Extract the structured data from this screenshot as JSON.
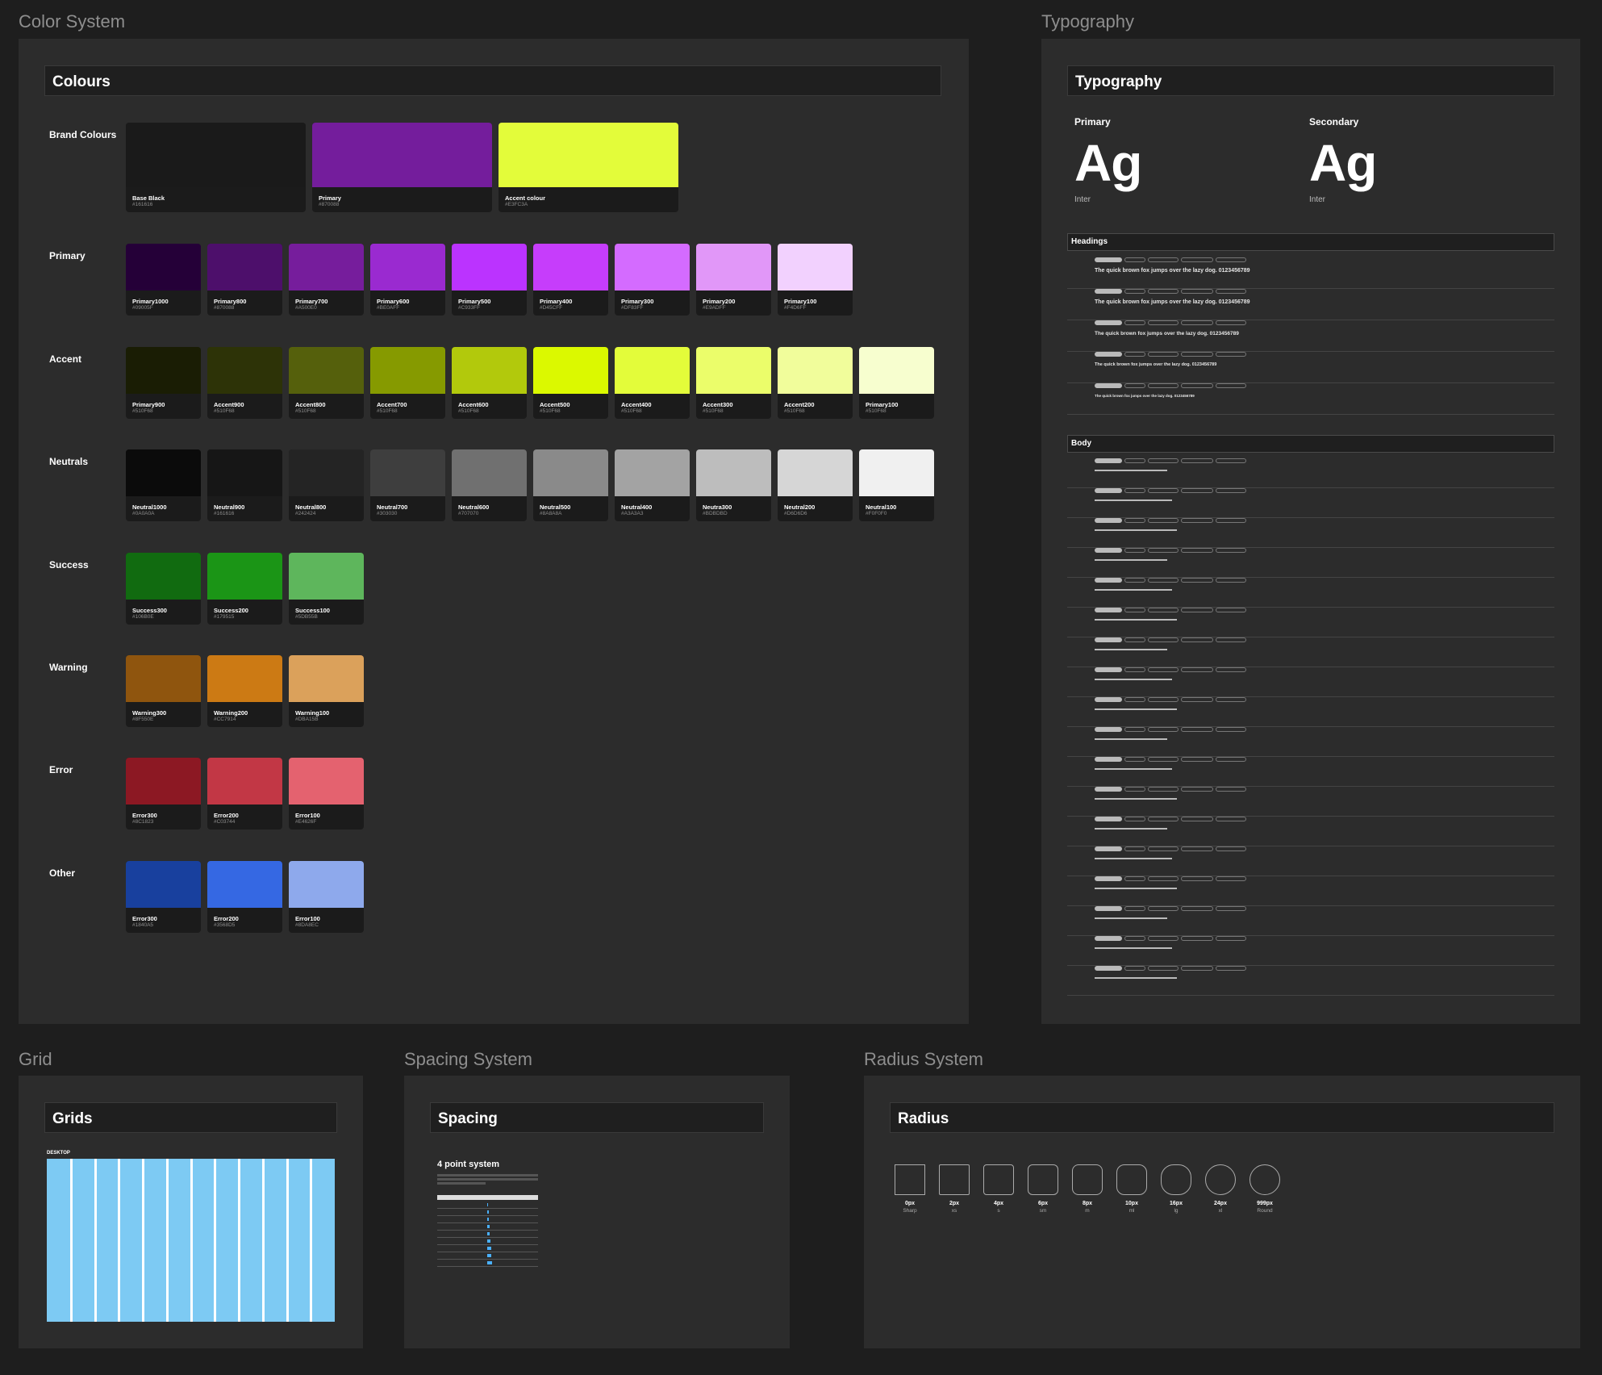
{
  "sections": {
    "color_system": "Color System",
    "typography": "Typography",
    "grid": "Grid",
    "spacing": "Spacing System",
    "radius": "Radius System"
  },
  "colours": {
    "header": "Colours",
    "groups": [
      {
        "label": "Brand Colours",
        "items": [
          {
            "name": "Base Black",
            "hex": "#161616",
            "color": "#1a1a1a"
          },
          {
            "name": "Primary",
            "hex": "#870088",
            "color": "#741d9c"
          },
          {
            "name": "Accent colour",
            "hex": "#E3FC3A",
            "color": "#e3fc3a"
          }
        ]
      },
      {
        "label": "Primary",
        "items": [
          {
            "name": "Primary1000",
            "hex": "#09005F",
            "color": "#250038"
          },
          {
            "name": "Primary800",
            "hex": "#870088",
            "color": "#4d0f6b"
          },
          {
            "name": "Primary700",
            "hex": "#A500E0",
            "color": "#761d9c"
          },
          {
            "name": "Primary600",
            "hex": "#BE0AFF",
            "color": "#9a2ad0"
          },
          {
            "name": "Primary500",
            "hex": "#C933FF",
            "color": "#bb33ff"
          },
          {
            "name": "Primary400",
            "hex": "#D45CFF",
            "color": "#c63dfb"
          },
          {
            "name": "Primary300",
            "hex": "#DF83FF",
            "color": "#d46bff"
          },
          {
            "name": "Primary200",
            "hex": "#E9ADFF",
            "color": "#e197f8"
          },
          {
            "name": "Primary100",
            "hex": "#F4D6FF",
            "color": "#f2d1fe"
          }
        ]
      },
      {
        "label": "Accent",
        "items": [
          {
            "name": "Primary900",
            "hex": "#510F68",
            "color": "#1a1d04"
          },
          {
            "name": "Accent900",
            "hex": "#510F68",
            "color": "#2d3307"
          },
          {
            "name": "Accent800",
            "hex": "#510F68",
            "color": "#55600c"
          },
          {
            "name": "Accent700",
            "hex": "#510F68",
            "color": "#869a00"
          },
          {
            "name": "Accent600",
            "hex": "#510F68",
            "color": "#b2c90c"
          },
          {
            "name": "Accent500",
            "hex": "#510F68",
            "color": "#dbf900"
          },
          {
            "name": "Accent400",
            "hex": "#510F68",
            "color": "#e3fc3a"
          },
          {
            "name": "Accent300",
            "hex": "#510F68",
            "color": "#ebfd6a"
          },
          {
            "name": "Accent200",
            "hex": "#510F68",
            "color": "#f1fd9b"
          },
          {
            "name": "Primary100",
            "hex": "#510F68",
            "color": "#f7fecf"
          }
        ]
      },
      {
        "label": "Neutrals",
        "items": [
          {
            "name": "Neutral1000",
            "hex": "#0A0A0A",
            "color": "#0b0b0b"
          },
          {
            "name": "Neutral900",
            "hex": "#161616",
            "color": "#161616"
          },
          {
            "name": "Neutral800",
            "hex": "#242424",
            "color": "#242424"
          },
          {
            "name": "Neutral700",
            "hex": "#303030",
            "color": "#3e3e3e"
          },
          {
            "name": "Neutral600",
            "hex": "#707070",
            "color": "#707070"
          },
          {
            "name": "Neutral500",
            "hex": "#8A8A8A",
            "color": "#8a8a8a"
          },
          {
            "name": "Neutral400",
            "hex": "#A3A3A3",
            "color": "#a3a3a3"
          },
          {
            "name": "Neutra300",
            "hex": "#BDBDBD",
            "color": "#bdbdbd"
          },
          {
            "name": "Neutral200",
            "hex": "#D6D6D6",
            "color": "#d6d6d6"
          },
          {
            "name": "Neutral100",
            "hex": "#F0F0F0",
            "color": "#f0f0f0"
          }
        ]
      },
      {
        "label": "Success",
        "items": [
          {
            "name": "Success300",
            "hex": "#106B0E",
            "color": "#116b10"
          },
          {
            "name": "Success200",
            "hex": "#179515",
            "color": "#1b9516"
          },
          {
            "name": "Success100",
            "hex": "#5DB55B",
            "color": "#5eb65c"
          }
        ]
      },
      {
        "label": "Warning",
        "items": [
          {
            "name": "Warning300",
            "hex": "#8F550E",
            "color": "#8f550e"
          },
          {
            "name": "Warning200",
            "hex": "#CC7914",
            "color": "#cc7a14"
          },
          {
            "name": "Warning100",
            "hex": "#DBA15B",
            "color": "#dba15b"
          }
        ]
      },
      {
        "label": "Error",
        "items": [
          {
            "name": "Error300",
            "hex": "#8C1823",
            "color": "#8c1823"
          },
          {
            "name": "Error200",
            "hex": "#C03744",
            "color": "#c23745"
          },
          {
            "name": "Error100",
            "hex": "#E4626F",
            "color": "#e4626f"
          }
        ]
      },
      {
        "label": "Other",
        "items": [
          {
            "name": "Error300",
            "hex": "#1840A5",
            "color": "#18409e"
          },
          {
            "name": "Error200",
            "hex": "#3568D5",
            "color": "#3568e3"
          },
          {
            "name": "Error100",
            "hex": "#8DA8EC",
            "color": "#8ea9ec"
          }
        ]
      }
    ]
  },
  "typography": {
    "header": "Typography",
    "primary_label": "Primary",
    "secondary_label": "Secondary",
    "specimen": "Ag",
    "primary_font": "Inter",
    "secondary_font": "Inter",
    "headings_label": "Headings",
    "body_label": "Body",
    "heading_samples": [
      "The quick brown fox jumps over the lazy dog. 0123456789",
      "The quick brown fox jumps over the lazy dog. 0123456789",
      "The quick brown fox jumps over the lazy dog. 0123456789",
      "The quick brown fox jumps over the lazy dog. 0123456789",
      "The quick brown fox jumps over the lazy dog. 0123456789"
    ]
  },
  "grid": {
    "header": "Grids",
    "label": "DESKTOP"
  },
  "spacing": {
    "header": "Spacing",
    "title": "4 point system"
  },
  "radius": {
    "header": "Radius",
    "items": [
      {
        "value": "0px",
        "name": "Sharp",
        "r": 0
      },
      {
        "value": "2px",
        "name": "xs",
        "r": 2
      },
      {
        "value": "4px",
        "name": "s",
        "r": 4
      },
      {
        "value": "6px",
        "name": "sm",
        "r": 6
      },
      {
        "value": "8px",
        "name": "m",
        "r": 8
      },
      {
        "value": "10px",
        "name": "ml",
        "r": 10
      },
      {
        "value": "16px",
        "name": "lg",
        "r": 16
      },
      {
        "value": "24px",
        "name": "xl",
        "r": 24
      },
      {
        "value": "999px",
        "name": "Round",
        "r": 999
      }
    ]
  }
}
